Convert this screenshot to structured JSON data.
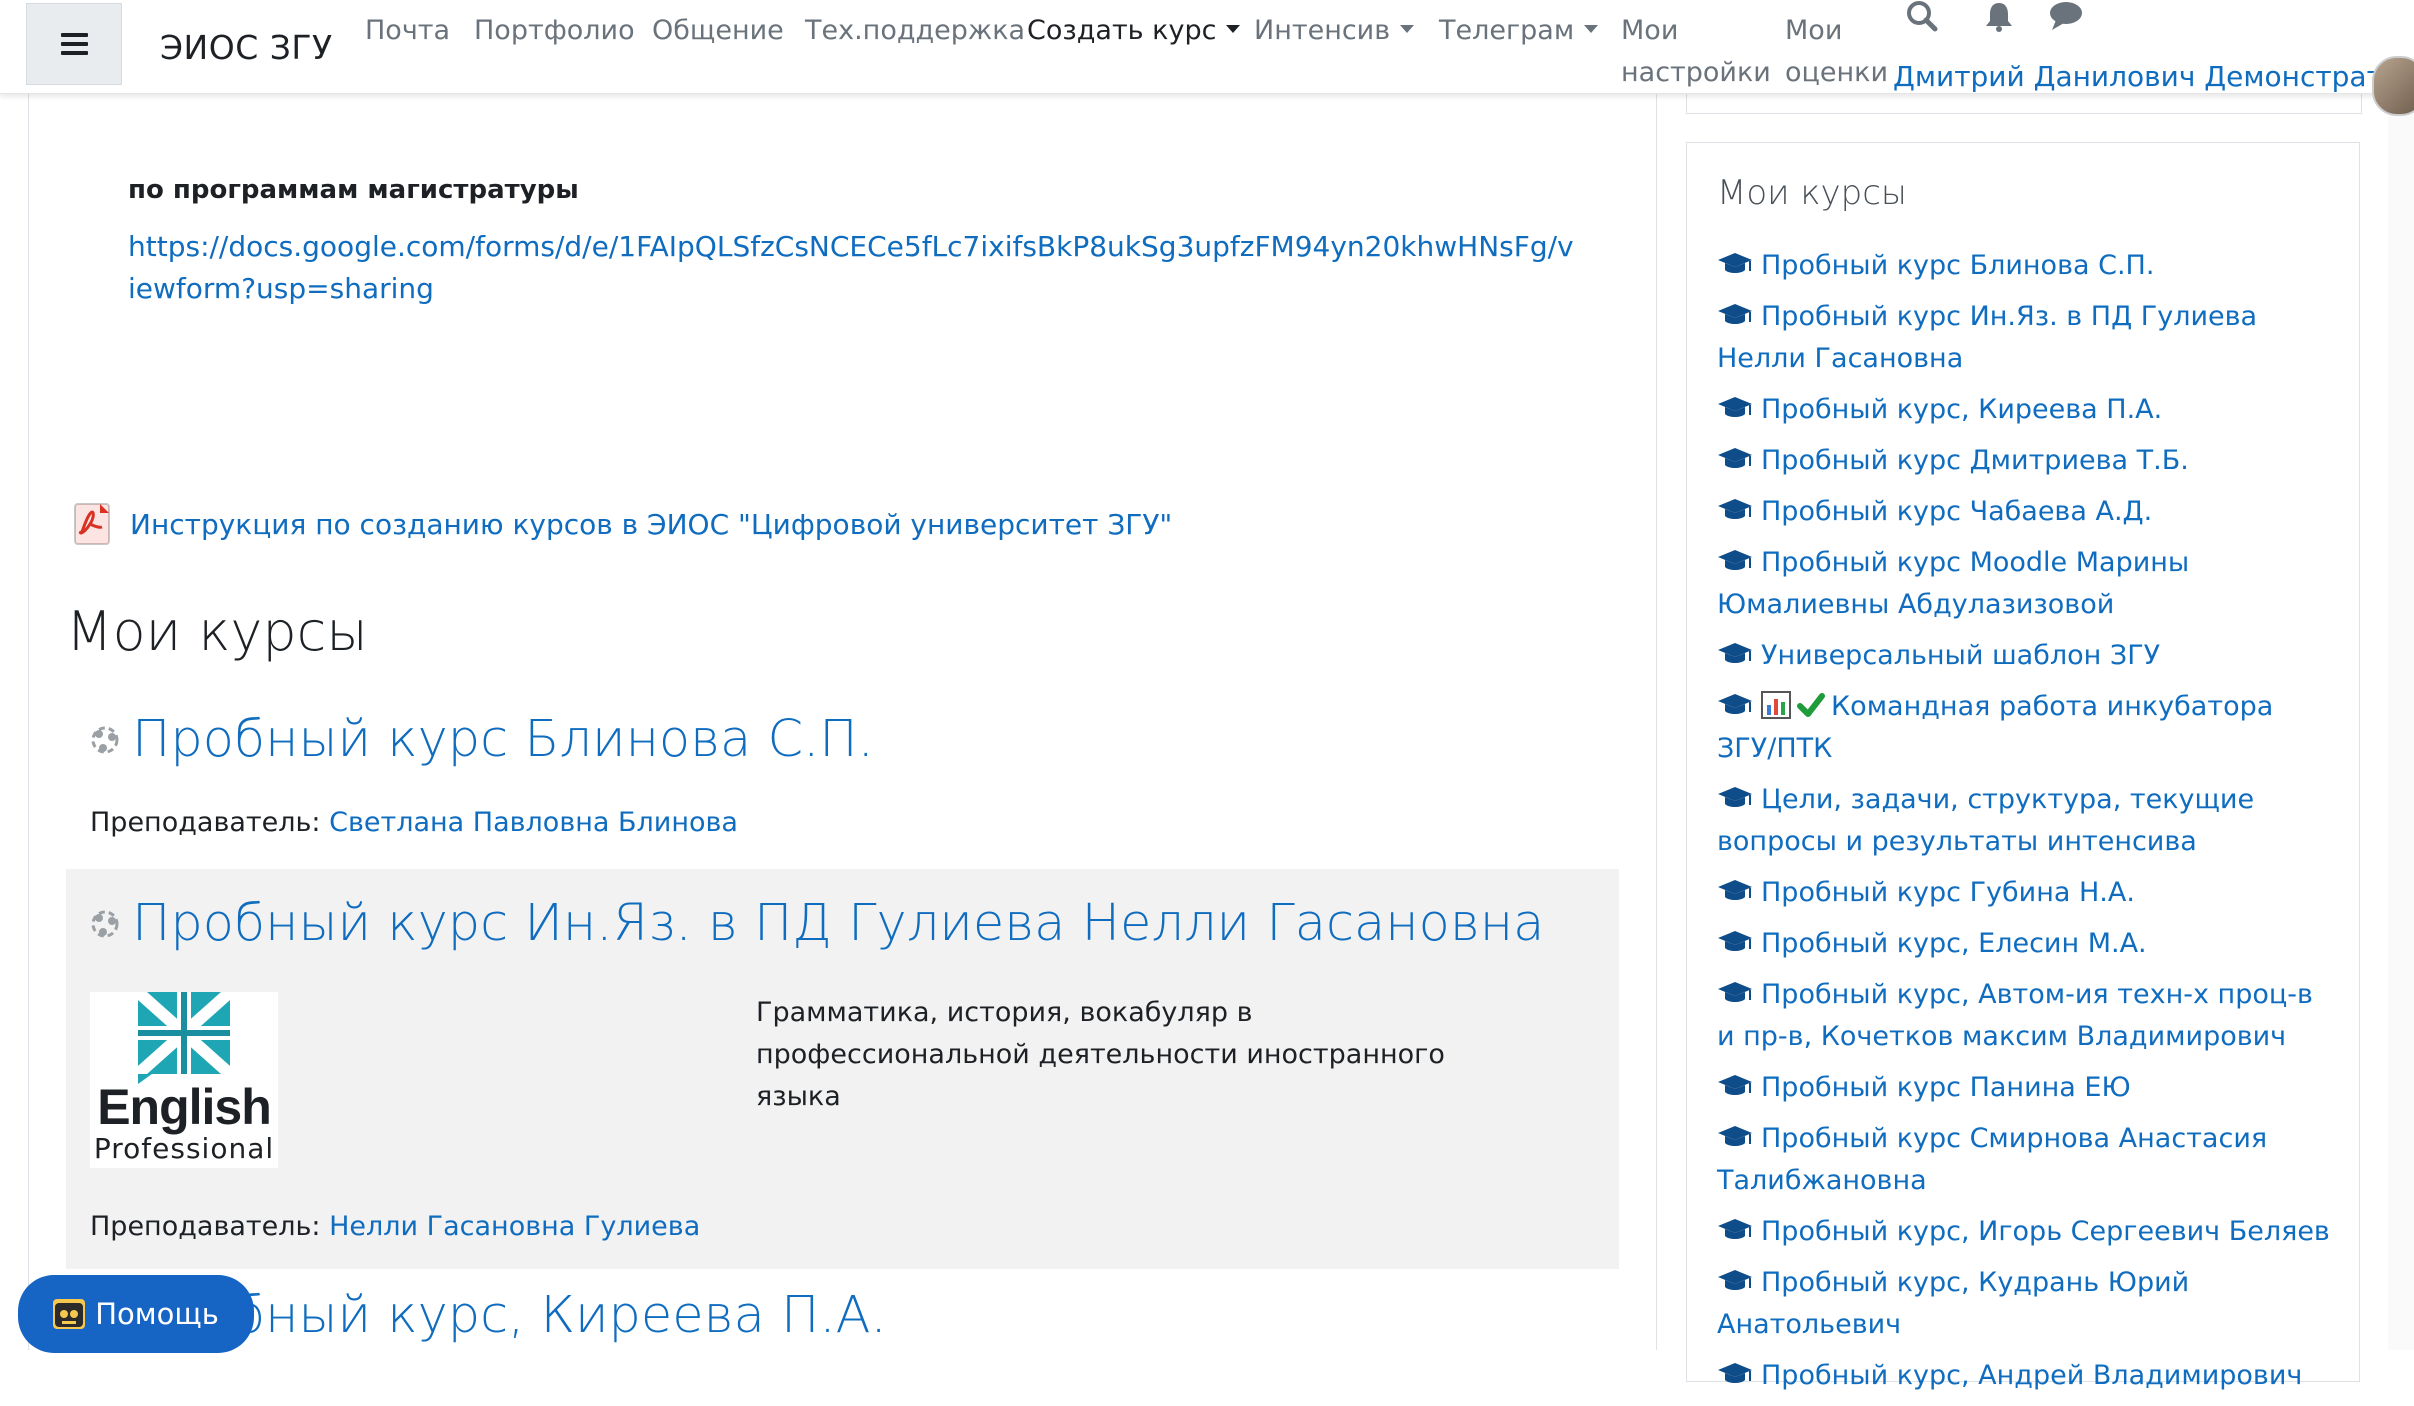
{
  "navbar": {
    "brand": "ЭИОС ЗГУ",
    "links": [
      {
        "label": "Почта"
      },
      {
        "label": "Портфолио"
      },
      {
        "label": "Общение"
      },
      {
        "label": "Тех.поддержка"
      },
      {
        "label": "Создать курс"
      },
      {
        "label": "Интенсив"
      },
      {
        "label": "Телеграм"
      },
      {
        "label1": "Мои",
        "label2": "настройки"
      },
      {
        "label1": "Мои",
        "label2": "оценки"
      }
    ],
    "user_name": "Дмитрий Данилович Демонстратор"
  },
  "main": {
    "bold_line": "по программам магистратуры",
    "form_url": "https://docs.google.com/forms/d/e/1FAIpQLSfzCsNCECe5fLc7ixifsBkP8ukSg3upfzFM94yn20khwHNsFg/viewform?usp=sharing",
    "pdf_link": "Инструкция по созданию курсов в ЭИОС \"Цифровой университет ЗГУ\"",
    "section_title": "Мои курсы",
    "teacher_prefix": "Преподаватель: ",
    "courses": [
      {
        "title": "Пробный курс Блинова С.П.",
        "teacher": "Светлана Павловна Блинова"
      },
      {
        "title": "Пробный курс Ин.Яз. в ПД Гулиева Нелли Гасановна",
        "teacher": "Нелли Гасановна Гулиева",
        "summary": "Грамматика, история, вокабуляр в профессиональной деятельности иностранного языка",
        "logo_line1": "English",
        "logo_line2": "Professional"
      },
      {
        "title": "Пробный курс, Киреева П.А."
      }
    ],
    "help_label": "Помощь"
  },
  "sidebar": {
    "title": "Мои курсы",
    "courses": [
      "Пробный курс Блинова С.П.",
      "Пробный курс Ин.Яз. в ПД Гулиева Нелли Гасановна",
      "Пробный курс, Киреева П.А.",
      "Пробный курс Дмитриева Т.Б.",
      "Пробный курс Чабаева А.Д.",
      "Пробный курс Moodle Марины Юмалиевны Абдулазизовой",
      "Универсальный шаблон ЗГУ",
      "Командная работа инкубатора ЗГУ/ПТК",
      "Цели, задачи, структура, текущие вопросы и результаты интенсива",
      "Пробный курс Губина Н.А.",
      "Пробный курс, Елесин М.А.",
      "Пробный курс, Автом-ия техн-х проц-в и пр-в, Кочетков максим Владимирович",
      "Пробный курс Панина ЕЮ",
      "Пробный курс Смирнова Анастасия Талибжановна",
      "Пробный курс, Игорь Сергеевич Беляев",
      "Пробный курс, Кудрань Юрий Анатольевич",
      "Пробный курс, Андрей Владимирович"
    ]
  },
  "colors": {
    "link": "#0f6cbf",
    "help_button": "#1664c4",
    "shaded_block": "#f2f2f2"
  }
}
